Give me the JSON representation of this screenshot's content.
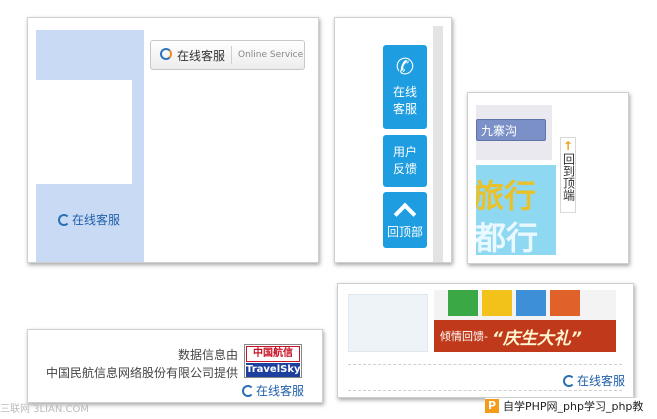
{
  "card1": {
    "online_service_cn": "在线客服",
    "online_service_en": "Online Service",
    "side_label": "在线客服"
  },
  "card2": {
    "btn_service_line1": "在线",
    "btn_service_line2": "客服",
    "btn_feedback_line1": "用户",
    "btn_feedback_line2": "反馈",
    "btn_top": "回顶部",
    "accent": "#1e9de0"
  },
  "card3": {
    "place_label": "九寨沟",
    "banner_line1": "旅行",
    "banner_line2": "都行",
    "back_to_top": "回到顶端"
  },
  "card4": {
    "line1": "数据信息由",
    "line2": "中国民航信息网络股份有限公司提供",
    "logo_top": "中国航信",
    "logo_bottom": "TravelSky",
    "service_label": "在线客服"
  },
  "card5": {
    "promo_small": "倾情回馈-",
    "promo_big": "“庆生大礼”",
    "service_label": "在线客服"
  },
  "watermarks": {
    "left": "三联网 3LIAN.COM",
    "right_logo": "P",
    "right_text": "自学PHP网_php学习_php教"
  }
}
